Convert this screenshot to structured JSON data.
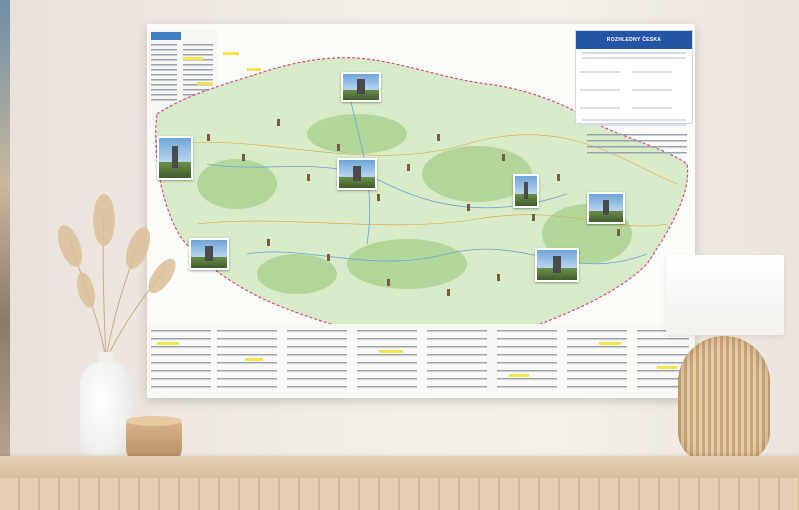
{
  "poster": {
    "legend_title": "ROZHLEDNY ČESKA"
  },
  "colors": {
    "legend_header": "#2455a4",
    "map_green": "#cfe7c1",
    "border_pink": "#d64b8a",
    "highlight_yellow": "#f7e34a"
  },
  "scene_objects": [
    "map-poster",
    "pampas-grass",
    "white-vase",
    "wooden-bowl",
    "rattan-lamp",
    "wooden-sideboard"
  ]
}
